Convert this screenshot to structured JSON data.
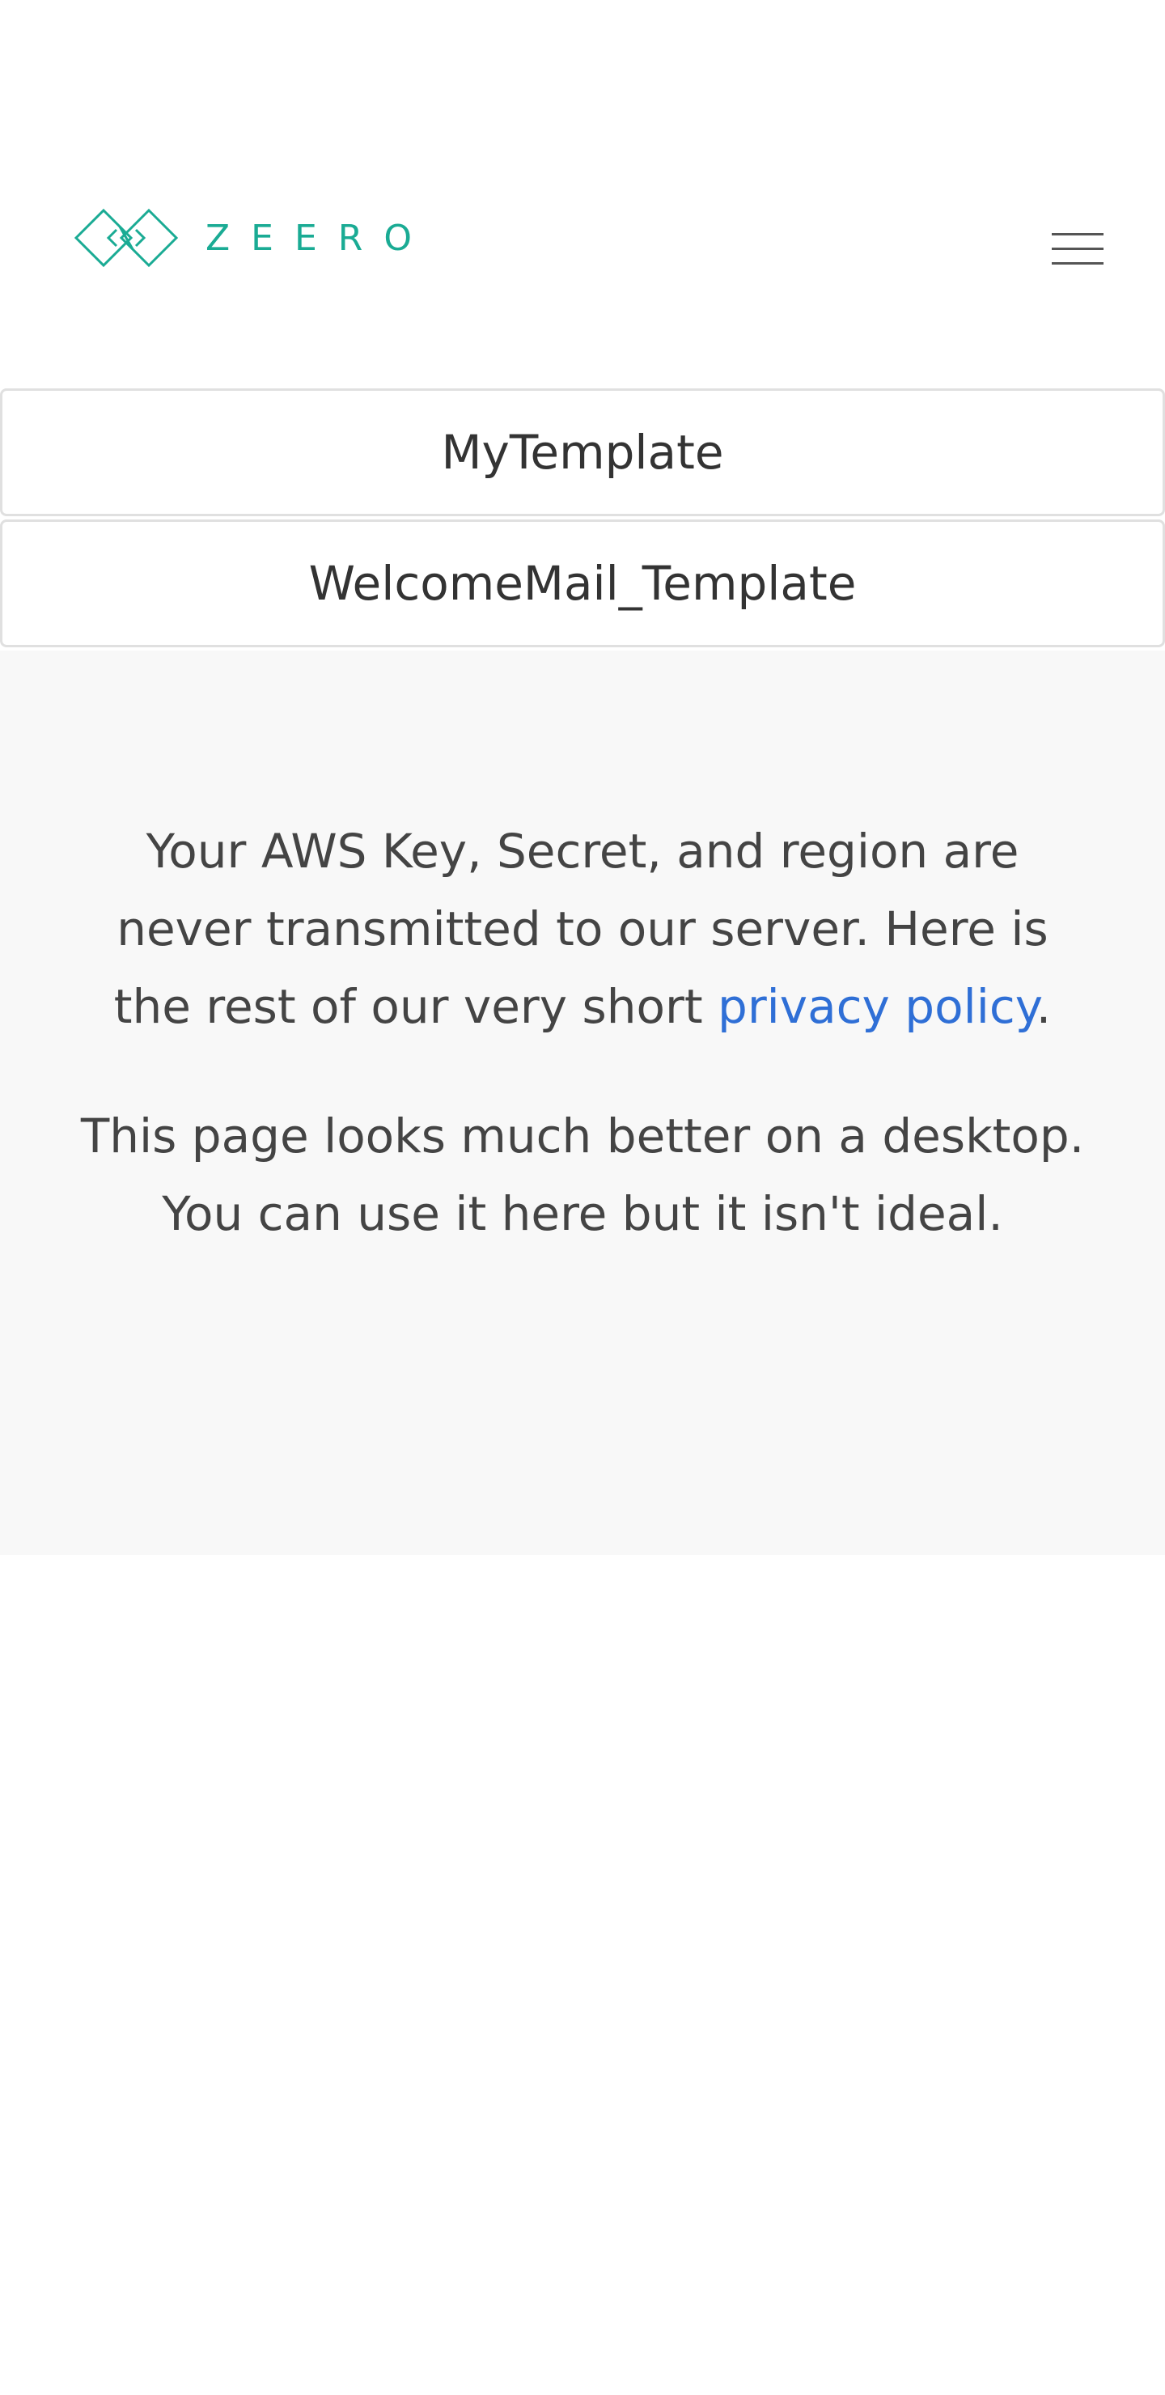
{
  "brand": {
    "name": "ZEERO",
    "accent_color": "#1aab94",
    "logo_icon": "zeero-diamond-logo-icon"
  },
  "header": {
    "menu_icon": "hamburger-menu-icon"
  },
  "templates": [
    {
      "label": "MyTemplate"
    },
    {
      "label": "WelcomeMail_Template"
    }
  ],
  "notice": {
    "privacy_text": "Your AWS Key, Secret, and region are never transmitted to our server. Here is the rest of our very short ",
    "privacy_link": "privacy policy",
    "privacy_end": ".",
    "desktop_text": "This page looks much better on a desktop. You can use it here but it isn't ideal.",
    "link_color": "#2f6fd6"
  }
}
